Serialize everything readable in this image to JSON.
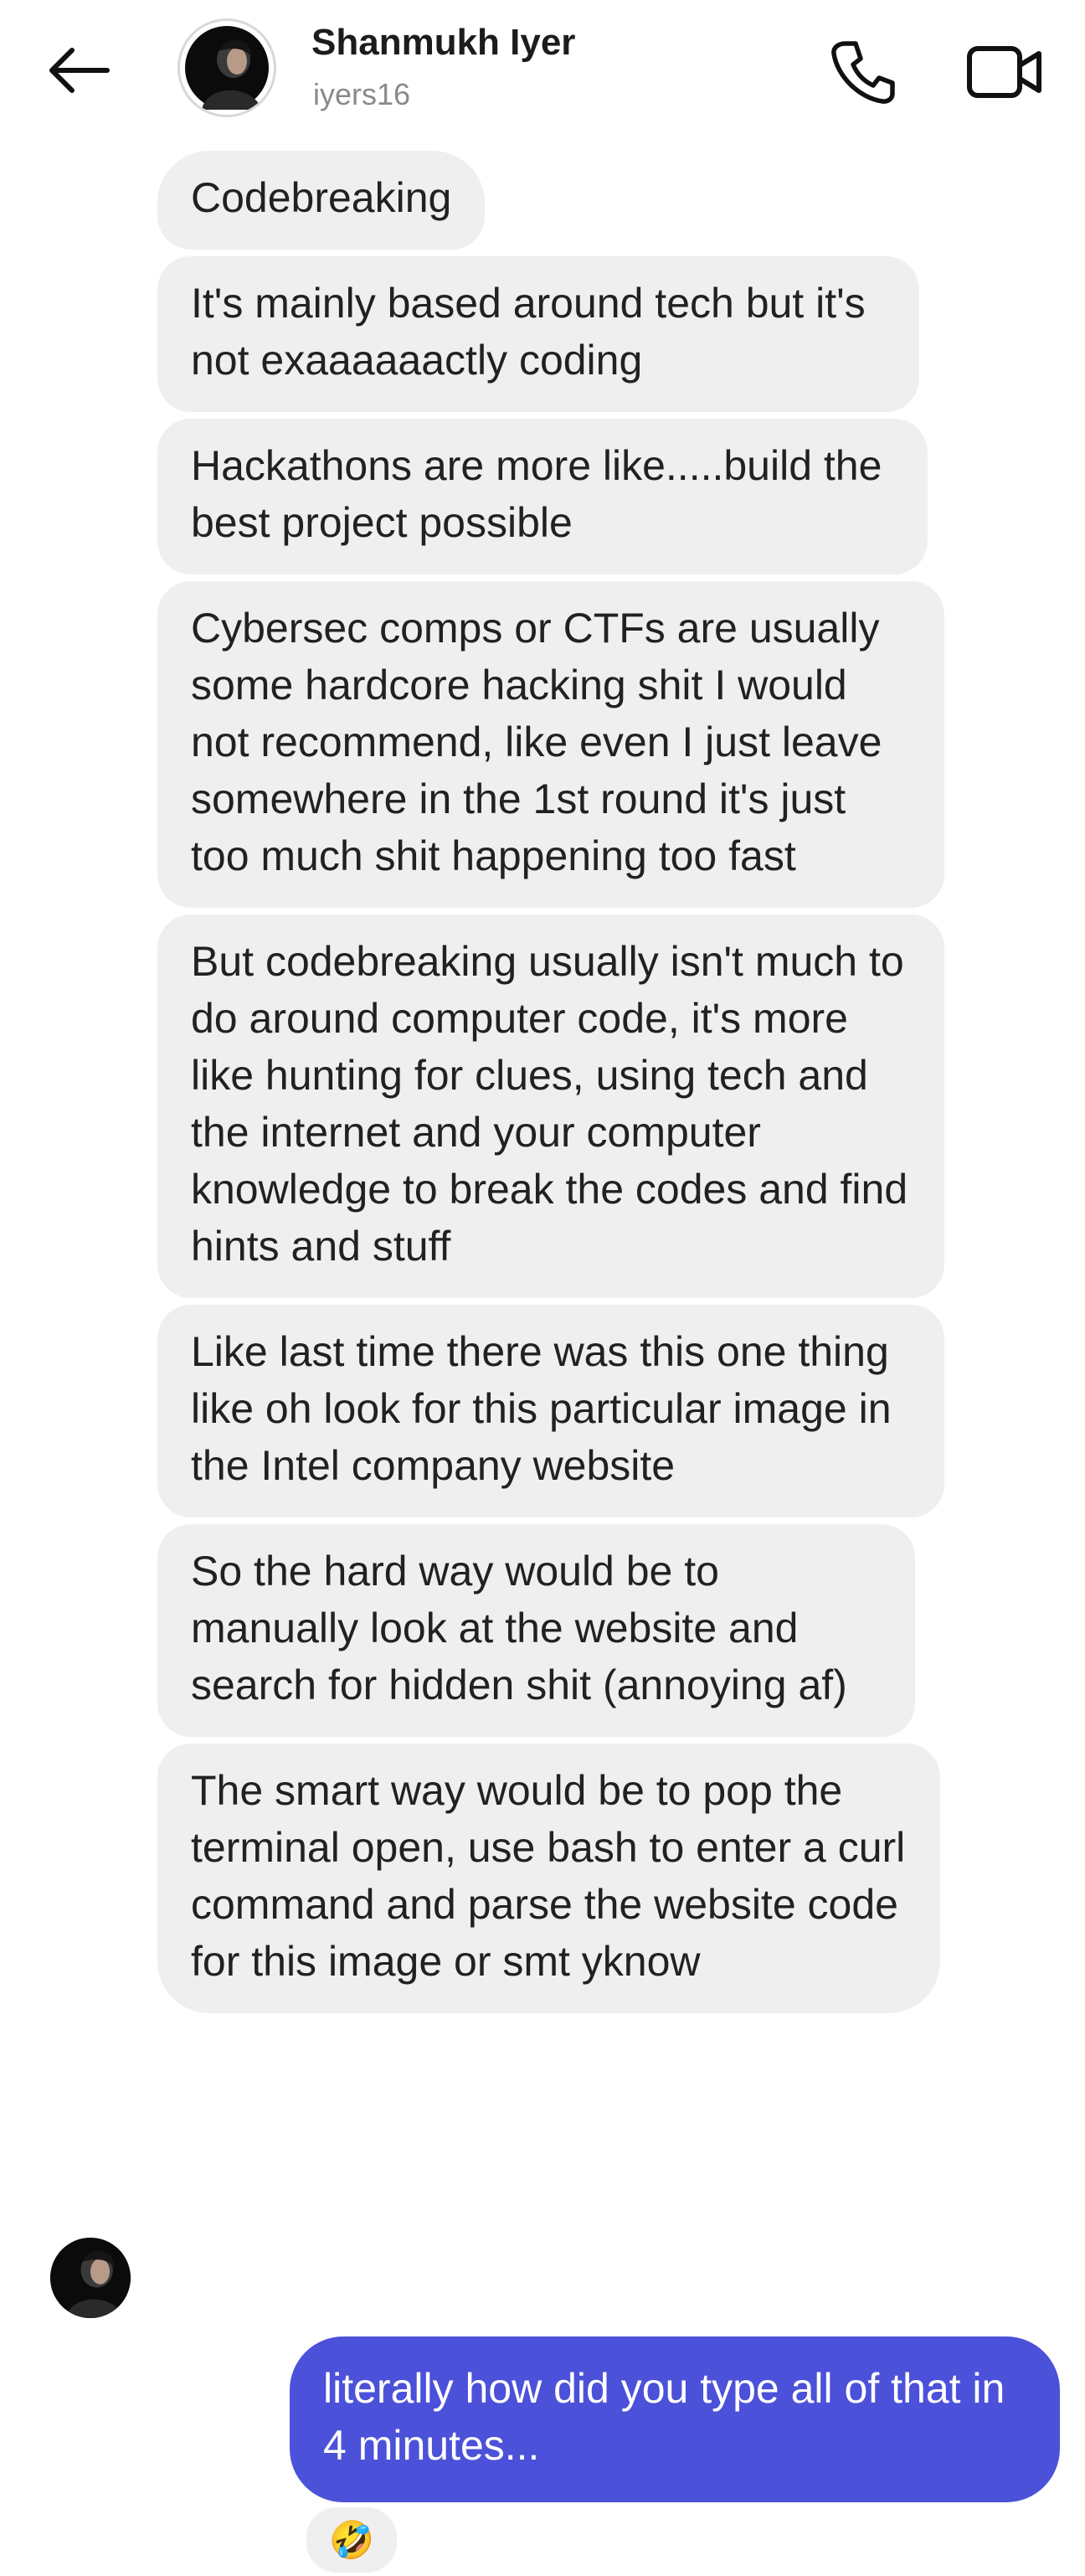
{
  "header": {
    "name": "Shanmukh Iyer",
    "username": "iyers16",
    "back_icon": "arrow-left-icon",
    "call_icon": "phone-icon",
    "video_icon": "video-camera-icon"
  },
  "messages": {
    "incoming": [
      "Codebreaking",
      "It's mainly based around tech but it's not exaaaaaactly coding",
      "Hackathons are more like.....build the best project possible",
      "Cybersec comps or CTFs are usually some hardcore hacking shit I would not recommend, like even I just leave somewhere in the 1st round it's just too much shit happening too fast",
      "But codebreaking usually isn't much to do around computer code, it's more like hunting for clues, using tech and the internet and your computer knowledge to break the codes and find hints and stuff",
      "Like last time there was this one thing like oh look for this particular image in the Intel company website",
      "So the hard way would be to manually look at the website and search for hidden shit (annoying af)",
      "The smart way would be to pop the terminal open, use bash to enter a curl command and parse the website code for this image or smt yknow"
    ],
    "outgoing": "literally how did you type all of that in 4 minutes...",
    "reaction": "🤣"
  },
  "colors": {
    "incoming_bubble": "#efefef",
    "outgoing_bubble": "#4b51d8",
    "username": "#8a8a8a"
  }
}
